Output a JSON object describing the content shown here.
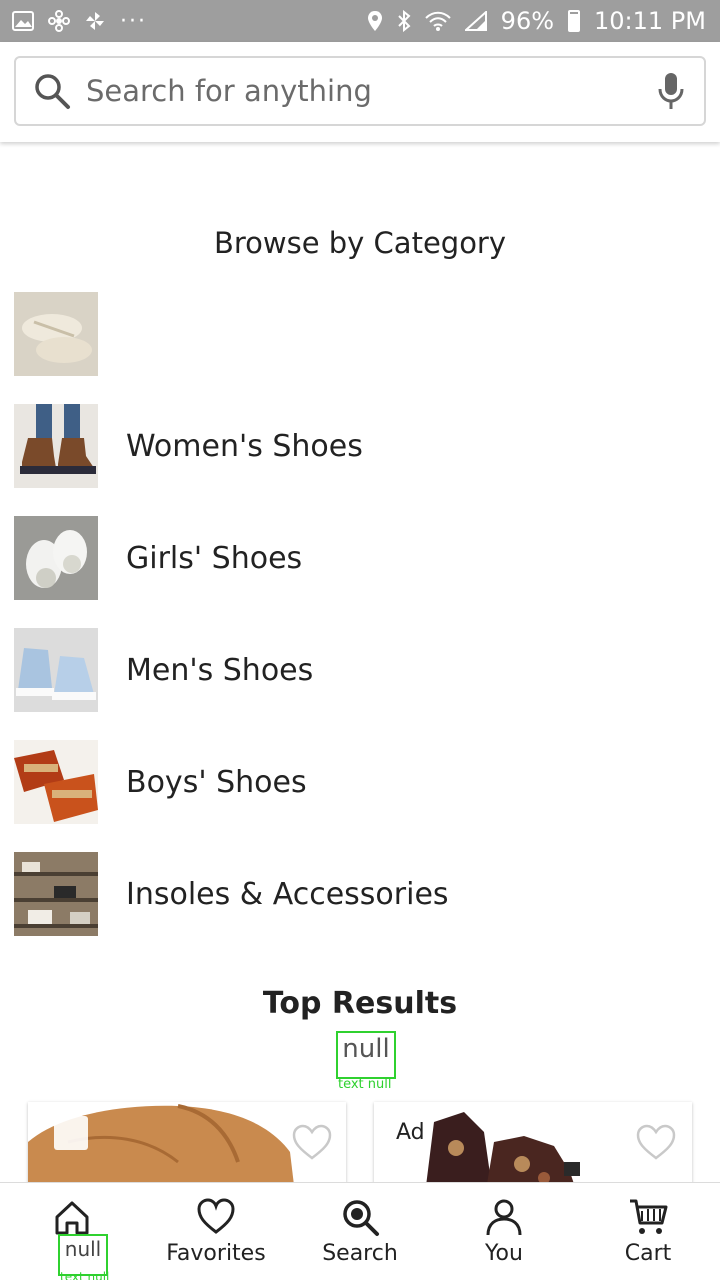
{
  "status_bar": {
    "battery": "96%",
    "time": "10:11 PM",
    "icons": [
      "image-icon",
      "pinwheel-icon",
      "fan-icon",
      "more-dots-icon",
      "location-icon",
      "bluetooth-icon",
      "wifi-icon",
      "signal-icon",
      "battery-icon"
    ]
  },
  "search": {
    "placeholder": "Search for anything"
  },
  "browse": {
    "title": "Browse by Category",
    "categories": [
      {
        "label": ""
      },
      {
        "label": "Women's Shoes"
      },
      {
        "label": "Girls' Shoes"
      },
      {
        "label": "Men's Shoes"
      },
      {
        "label": "Boys' Shoes"
      },
      {
        "label": "Insoles & Accessories"
      }
    ]
  },
  "top_results": {
    "title": "Top Results",
    "overlay_text": "null",
    "overlay_caption": "text null",
    "cards": [
      {
        "badge": ""
      },
      {
        "badge": "Ad"
      }
    ]
  },
  "bottom_nav": {
    "items": [
      {
        "label": "null",
        "caption": "text null"
      },
      {
        "label": "Favorites"
      },
      {
        "label": "Search"
      },
      {
        "label": "You"
      },
      {
        "label": "Cart"
      }
    ]
  },
  "colors": {
    "status_bar": "#9e9e9e",
    "debug_box": "#2fd12f"
  }
}
